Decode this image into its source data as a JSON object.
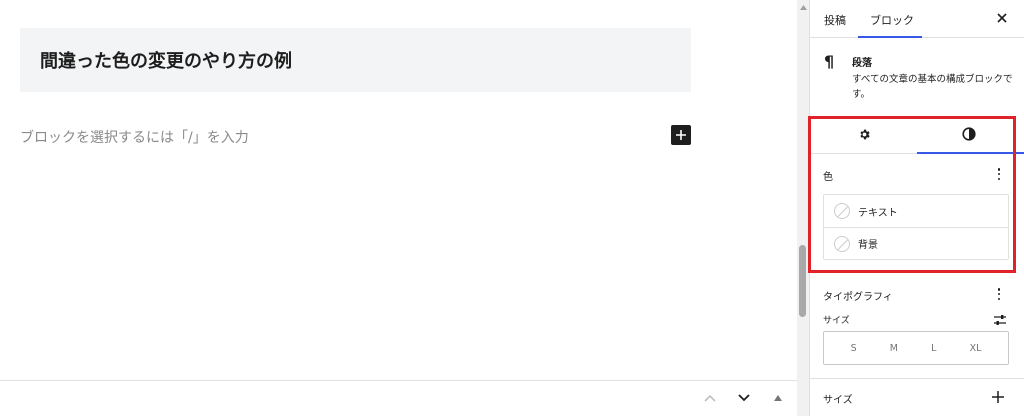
{
  "editor": {
    "heading_text": "間違った色の変更のやり方の例",
    "placeholder_text": "ブロックを選択するには「/」を入力"
  },
  "sidebar": {
    "tabs": [
      {
        "label": "投稿"
      },
      {
        "label": "ブロック"
      }
    ],
    "active_tab": "ブロック",
    "block_card": {
      "icon": "paragraph-icon",
      "title": "段落",
      "description": "すべての文章の基本の構成ブロックです。"
    },
    "sub_tabs": [
      {
        "icon": "gear-icon",
        "name": "settings"
      },
      {
        "icon": "contrast-icon",
        "name": "styles"
      }
    ],
    "color_panel": {
      "title": "色",
      "items": [
        {
          "label": "テキスト"
        },
        {
          "label": "背景"
        }
      ]
    },
    "typography_panel": {
      "title": "タイポグラフィ",
      "size_label": "サイズ",
      "sizes": [
        "S",
        "M",
        "L",
        "XL"
      ]
    },
    "dimensions_panel": {
      "title": "サイズ"
    }
  },
  "colors": {
    "accent": "#3858e9",
    "highlight": "#e0222a"
  }
}
